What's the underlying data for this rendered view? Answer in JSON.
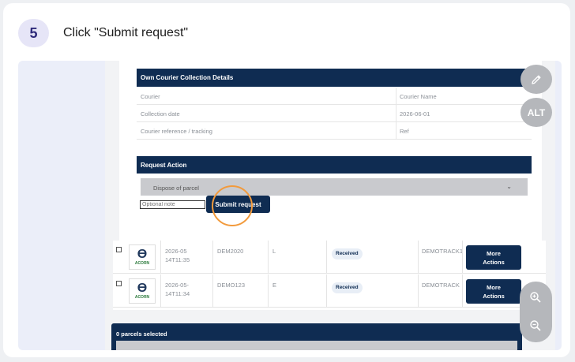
{
  "step": {
    "number": "5",
    "instruction": "Click \"Submit request\""
  },
  "courier_section": {
    "title": "Own Courier Collection Details",
    "rows": [
      {
        "label": "Courier",
        "value": "Courier Name"
      },
      {
        "label": "Collection date",
        "value": "2026-06-01"
      },
      {
        "label": "Courier reference / tracking",
        "value": "Ref"
      }
    ]
  },
  "request_section": {
    "title": "Request Action",
    "selected_action": "Dispose of parcel",
    "note_placeholder": "Optional note",
    "submit_label": "Submit request"
  },
  "table": {
    "rows": [
      {
        "logo_text": "ACORN",
        "date_line1": "2026-05",
        "date_line2": "14T11:35",
        "ref": "DEM2020",
        "size": "L",
        "status": "Received",
        "tracking": "DEMOTRACK1",
        "action_line1": "More",
        "action_line2": "Actions"
      },
      {
        "logo_text": "ACORN",
        "date_line1": "2026-05-",
        "date_line2": "14T11:34",
        "ref": "DEMO123",
        "size": "E",
        "status": "Received",
        "tracking": "DEMOTRACK",
        "action_line1": "More",
        "action_line2": "Actions"
      }
    ]
  },
  "footer": {
    "selected_label": "0 parcels selected"
  },
  "tools": {
    "edit_icon": "pencil-icon",
    "alt_label": "ALT",
    "zoom_in_icon": "zoom-in-icon",
    "zoom_out_icon": "zoom-out-icon"
  },
  "colors": {
    "navy": "#0f2c52",
    "highlight": "#f29a3c",
    "badge_bg": "#e6e5f7"
  }
}
